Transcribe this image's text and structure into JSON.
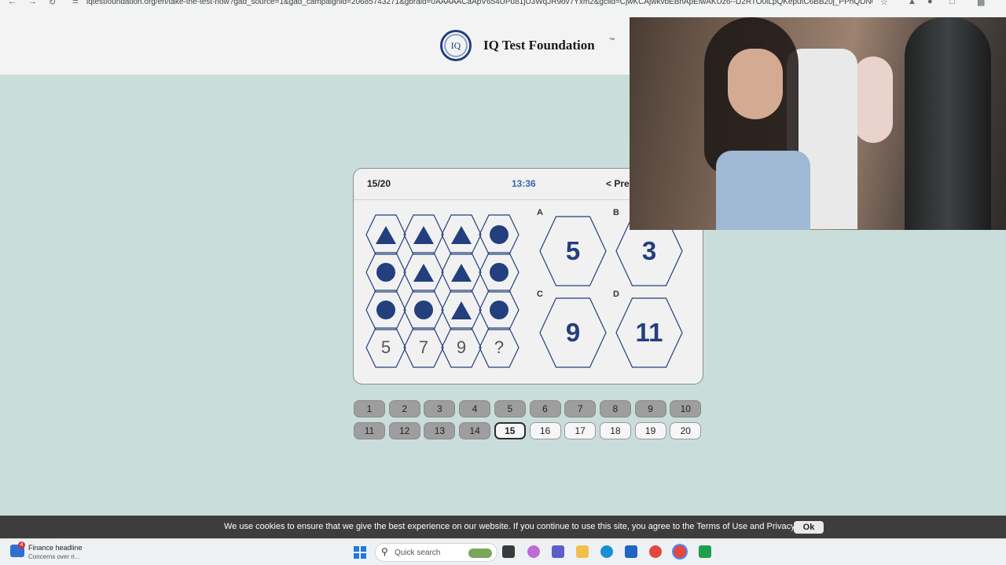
{
  "browser": {
    "url": "iqtestfoundation.org/en/take-the-test-now?gad_source=1&gad_campaignid=20685743271&gbraid=0AAAAACaApV654UPu81jU3WqJR9ov7Yxm2&gclid=CjwKCAjwkvbEBhApEiwAKUz6--D2RTO0iLpQKeputC6BB20j_PPhQDNOugb..."
  },
  "header": {
    "logo_text": "IQ",
    "brand": "IQ Test Foundation",
    "trademark": "™"
  },
  "quiz": {
    "counter": "15/20",
    "timer": "13:36",
    "prev_label": "< Pre",
    "grid": [
      [
        "triangle",
        "triangle",
        "triangle",
        "circle"
      ],
      [
        "circle",
        "triangle",
        "triangle",
        "circle"
      ],
      [
        "circle",
        "circle",
        "triangle",
        "circle"
      ],
      [
        "5",
        "7",
        "9",
        "?"
      ]
    ],
    "options": [
      {
        "letter": "A",
        "value": "5"
      },
      {
        "letter": "B",
        "value": "3"
      },
      {
        "letter": "C",
        "value": "9"
      },
      {
        "letter": "D",
        "value": "11"
      }
    ]
  },
  "question_nav": {
    "current": 15,
    "answered_through": 14,
    "items": [
      "1",
      "2",
      "3",
      "4",
      "5",
      "6",
      "7",
      "8",
      "9",
      "10",
      "11",
      "12",
      "13",
      "14",
      "15",
      "16",
      "17",
      "18",
      "19",
      "20"
    ]
  },
  "cookie": {
    "text": "We use cookies to ensure that we give the best experience on our website. If you continue to use this site, you agree to the Terms of Use and Privacy Policy.",
    "ok_label": "Ok"
  },
  "taskbar": {
    "news_badge": "4",
    "news_title": "Finance headline",
    "news_sub": "Concerns over ri...",
    "search_placeholder": "Quick search"
  },
  "colors": {
    "page_bg": "#c9dedb",
    "shape_blue": "#233f7d",
    "timer_blue": "#3a67a8",
    "cookie_bg": "#3d3d3d"
  }
}
